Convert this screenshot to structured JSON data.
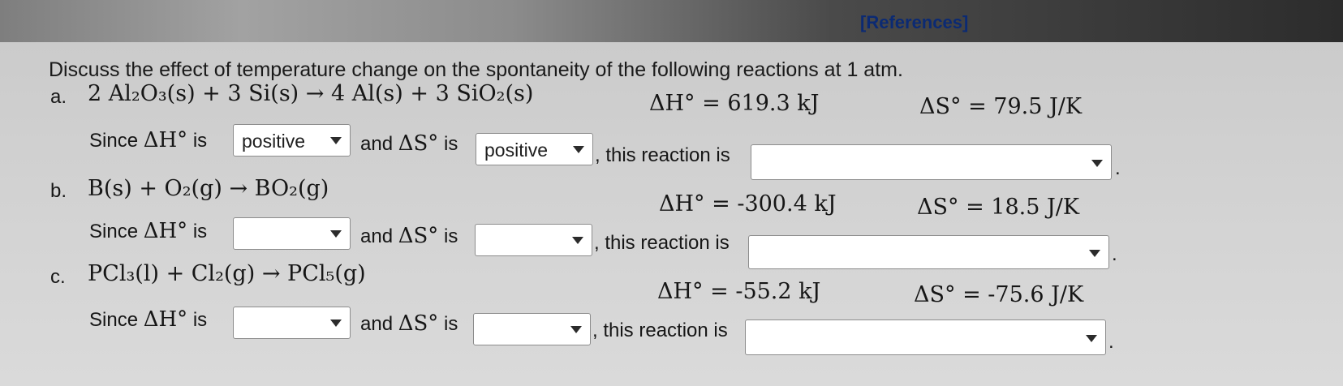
{
  "header": {
    "references_label": "[References]"
  },
  "question": "Discuss the effect of temperature change on the spontaneity of the following reactions at 1 atm.",
  "reactions": [
    {
      "letter": "a.",
      "equation": "2 Al₂O₃(s) + 3 Si(s) → 4 Al(s) + 3 SiO₂(s)",
      "dH": "ΔH° = 619.3 kJ",
      "dS": "ΔS° = 79.5 J/K",
      "dH_sign": "positive",
      "dS_sign": "positive",
      "conclusion": ""
    },
    {
      "letter": "b.",
      "equation": "B(s) + O₂(g) → BO₂(g)",
      "dH": "ΔH° = -300.4 kJ",
      "dS": "ΔS° = 18.5 J/K",
      "dH_sign": "",
      "dS_sign": "",
      "conclusion": ""
    },
    {
      "letter": "c.",
      "equation": "PCl₃(l) + Cl₂(g) → PCl₅(g)",
      "dH": "ΔH° = -55.2 kJ",
      "dS": "ΔS° = -75.6 J/K",
      "dH_sign": "",
      "dS_sign": "",
      "conclusion": ""
    }
  ],
  "sentence": {
    "since": "Since",
    "dH_symbol": "ΔH°",
    "is": "is",
    "and": "and",
    "dS_symbol": "ΔS°",
    "this_reaction_is": ", this reaction is",
    "period": "."
  },
  "icons": {
    "dropdown_caret": "chevron-down-icon"
  }
}
